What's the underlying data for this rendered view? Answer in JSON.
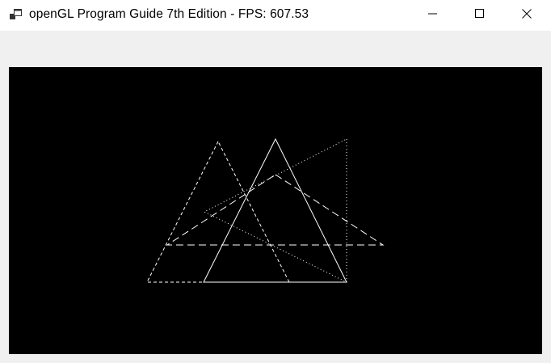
{
  "window": {
    "title": "openGL Program Guide 7th Edition - FPS: 607.53",
    "icon": "app-windows-icon",
    "controls": {
      "minimize_icon": "minimize-icon",
      "maximize_icon": "maximize-icon",
      "close_icon": "close-icon"
    }
  },
  "canvas": {
    "background": "#000000",
    "line_color": "#ffffff",
    "shapes": [
      {
        "name": "solid-triangle",
        "style": "solid"
      },
      {
        "name": "short-dashed-triangle",
        "style": "short-dash"
      },
      {
        "name": "dotted-triangle",
        "style": "dotted"
      },
      {
        "name": "long-dashed-triangle",
        "style": "long-dash"
      }
    ]
  }
}
